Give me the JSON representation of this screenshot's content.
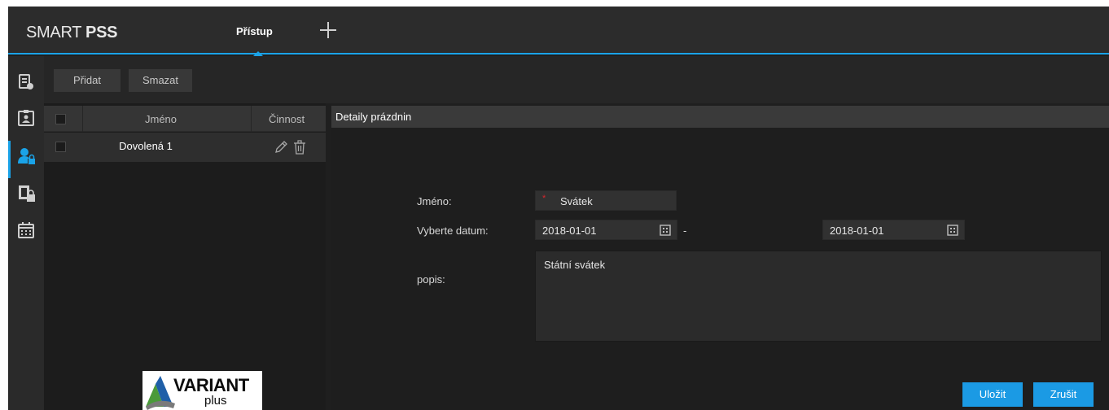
{
  "app": {
    "logo_light": "SMART ",
    "logo_bold": "PSS",
    "active_tab": "Přístup",
    "add_tab_icon": "plus-icon",
    "accent": "#1aa3e8"
  },
  "rail": {
    "items": [
      {
        "icon": "access-record-icon",
        "active": false
      },
      {
        "icon": "person-card-icon",
        "active": false
      },
      {
        "icon": "user-lock-icon",
        "active": true
      },
      {
        "icon": "door-lock-icon",
        "active": false
      },
      {
        "icon": "calendar-icon",
        "active": false
      }
    ]
  },
  "toolbar": {
    "add_label": "Přidat",
    "delete_label": "Smazat"
  },
  "list": {
    "columns": {
      "name": "Jméno",
      "action": "Činnost"
    },
    "rows": [
      {
        "name": "Dovolená 1",
        "checked": false
      }
    ]
  },
  "details": {
    "title": "Detaily prázdnin",
    "name_label": "Jméno:",
    "name_value": "Svátek",
    "required_mark": "*",
    "date_label": "Vyberte datum:",
    "date_from": "2018-01-01",
    "date_separator": "-",
    "date_to": "2018-01-01",
    "desc_label": "popis:",
    "desc_value": "Státní svátek",
    "save_label": "Uložit",
    "cancel_label": "Zrušit"
  },
  "watermark": {
    "line1": "VARIANT",
    "line2": "plus"
  }
}
